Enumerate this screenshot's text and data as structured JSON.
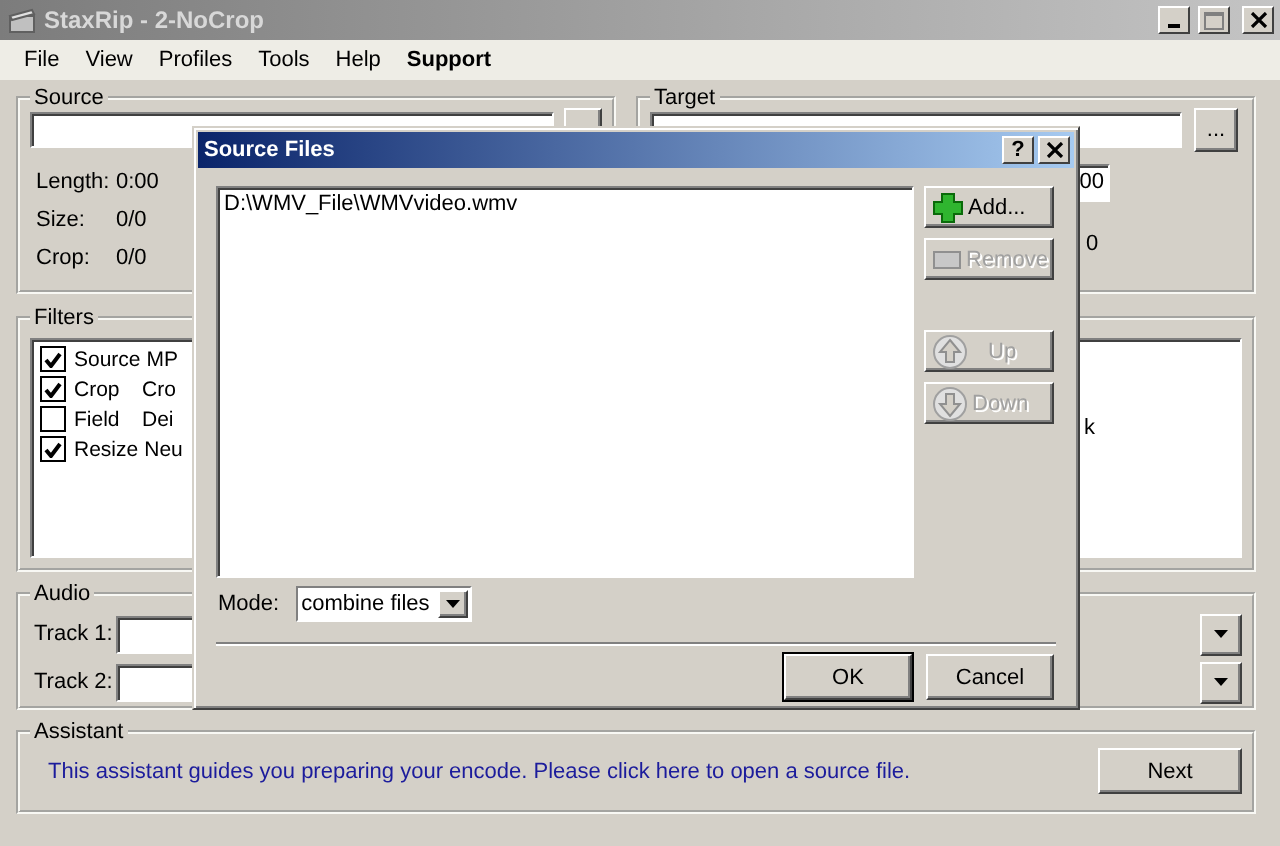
{
  "window": {
    "title": "StaxRip - 2-NoCrop"
  },
  "menu": [
    {
      "label": "File",
      "bold": false
    },
    {
      "label": "View",
      "bold": false
    },
    {
      "label": "Profiles",
      "bold": false
    },
    {
      "label": "Tools",
      "bold": false
    },
    {
      "label": "Help",
      "bold": false
    },
    {
      "label": "Support",
      "bold": true
    }
  ],
  "source": {
    "title": "Source",
    "info": [
      {
        "label": "Length:",
        "value": "0:00"
      },
      {
        "label": "Size:",
        "value": "0/0"
      },
      {
        "label": "Crop:",
        "value": "0/0"
      }
    ]
  },
  "target": {
    "title": "Target",
    "browse_label": "...",
    "partial_field": "00",
    "partial_text": "0"
  },
  "filters": {
    "title": "Filters",
    "items": [
      {
        "name": "Source",
        "detail": "MP",
        "checked": true
      },
      {
        "name": "Crop",
        "detail": "Cro",
        "checked": true
      },
      {
        "name": "Field",
        "detail": "Dei",
        "checked": false
      },
      {
        "name": "Resize",
        "detail": "Neu",
        "checked": true
      }
    ],
    "side_text": "k"
  },
  "audio": {
    "title": "Audio",
    "tracks": [
      {
        "label": "Track 1:"
      },
      {
        "label": "Track 2:"
      }
    ]
  },
  "assistant": {
    "title": "Assistant",
    "message": "This assistant guides you preparing your encode. Please click here to open a source file.",
    "button": "Next"
  },
  "dialog": {
    "title": "Source Files",
    "help": "?",
    "files": [
      "D:\\WMV_File\\WMVvideo.wmv"
    ],
    "side_buttons": [
      {
        "label": "Add...",
        "kind": "add",
        "disabled": false
      },
      {
        "label": "Remove",
        "kind": "remove",
        "disabled": true
      },
      {
        "label": "Up",
        "kind": "up",
        "disabled": true
      },
      {
        "label": "Down",
        "kind": "down",
        "disabled": true
      }
    ],
    "mode": {
      "label": "Mode:",
      "value": "combine files"
    },
    "buttons": [
      {
        "label": "OK",
        "default": true
      },
      {
        "label": "Cancel",
        "default": false
      }
    ]
  }
}
